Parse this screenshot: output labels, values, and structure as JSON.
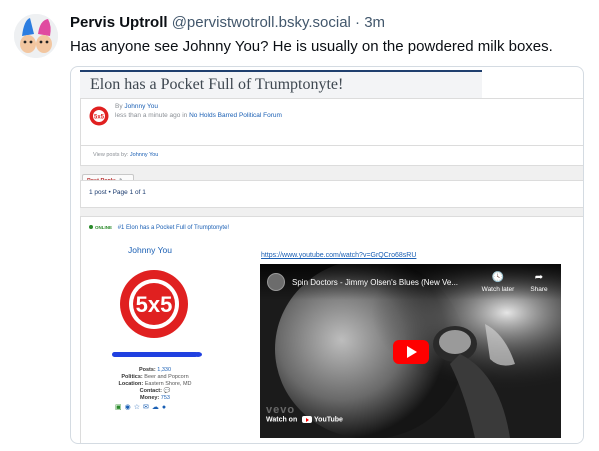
{
  "post": {
    "author_name": "Pervis Uptroll",
    "handle": "@pervistwotroll.bsky.social",
    "separator": "·",
    "time_ago": "3m",
    "text": "Has anyone see Johnny You?  He is usually on the powdered milk boxes."
  },
  "forum": {
    "topic_title": "Elon has a Pocket Full of Trumptonyte!",
    "by_prefix": "By",
    "by_author": "Johnny You",
    "time_text": "less than a minute ago in",
    "forum_name": "No Holds Barred Political Forum",
    "view_posts_prefix": "View posts by:",
    "view_posts_author": "Johnny You",
    "post_reply_label": "Post Reply",
    "pager_text": "1 post • Page 1 of 1",
    "online_label": "ONLINE",
    "post_title": "#1 Elon has a Pocket Full of Trumptonyte!",
    "post_author": "Johnny You",
    "author_logo_text": "5x5",
    "stats": {
      "posts_label": "Posts:",
      "posts_value": "1,330",
      "politics_label": "Politics:",
      "politics_value": "Beer and Popcorn",
      "location_label": "Location:",
      "location_value": "Eastern Shore, MD",
      "contact_label": "Contact:",
      "money_label": "Money:",
      "money_value": "753"
    },
    "youtube_url": "https://www.youtube.com/watch?v=GrQCro68sRU"
  },
  "video": {
    "title": "Spin Doctors - Jimmy Olsen's Blues (New Ve...",
    "watch_later_label": "Watch later",
    "share_label": "Share",
    "watch_on_label": "Watch on",
    "youtube_label": "YouTube",
    "watermark_text": "vevo"
  },
  "colors": {
    "link": "#1a5fb4",
    "bar_blue": "#2040e0",
    "youtube_red": "#ff0000",
    "logo_red": "#e02020"
  },
  "icons": [
    "troll-avatar",
    "site-logo-icon",
    "reply-arrow-icon",
    "online-dot-icon",
    "speech-bubble-icon",
    "clock-icon",
    "share-arrow-icon",
    "play-icon",
    "youtube-logo-icon"
  ]
}
